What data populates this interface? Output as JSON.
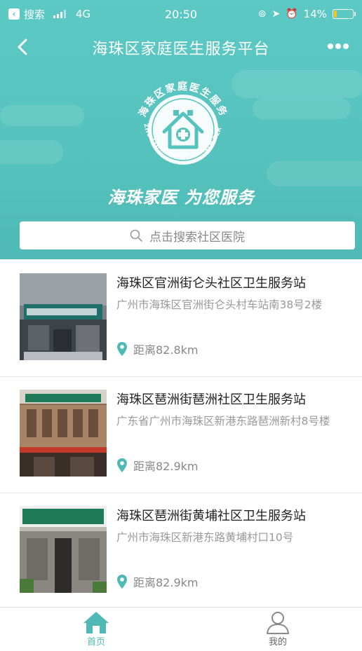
{
  "status_bar": {
    "back_app": "搜索",
    "network": "4G",
    "time": "20:50",
    "battery": "14%",
    "battery_level": 0.14
  },
  "nav": {
    "title": "海珠区家庭医生服务平台"
  },
  "banner": {
    "logo_text_cn": "海珠区家庭医生服务",
    "logo_text_en": "HAIZHU COMMUNITY HEALTH SERVICE",
    "slogan": "海珠家医 为您服务"
  },
  "search": {
    "placeholder": "点击搜索社区医院"
  },
  "clinics": [
    {
      "name": "海珠区官洲街仑头社区卫生服务站",
      "address": "广州市海珠区官洲街仑头村车站南38号2楼",
      "distance": "距离82.8km"
    },
    {
      "name": "海珠区琶洲街琶洲社区卫生服务站",
      "address": "广东省广州市海珠区新港东路琶洲新村8号楼",
      "distance": "距离82.9km"
    },
    {
      "name": "海珠区琶洲街黄埔社区卫生服务站",
      "address": "广州市海珠区新港东路黄埔村口10号",
      "distance": "距离82.9km"
    }
  ],
  "tabbar": {
    "home": "首页",
    "mine": "我的"
  },
  "colors": {
    "accent": "#55c2bd",
    "location_pin": "#4fbab5"
  }
}
